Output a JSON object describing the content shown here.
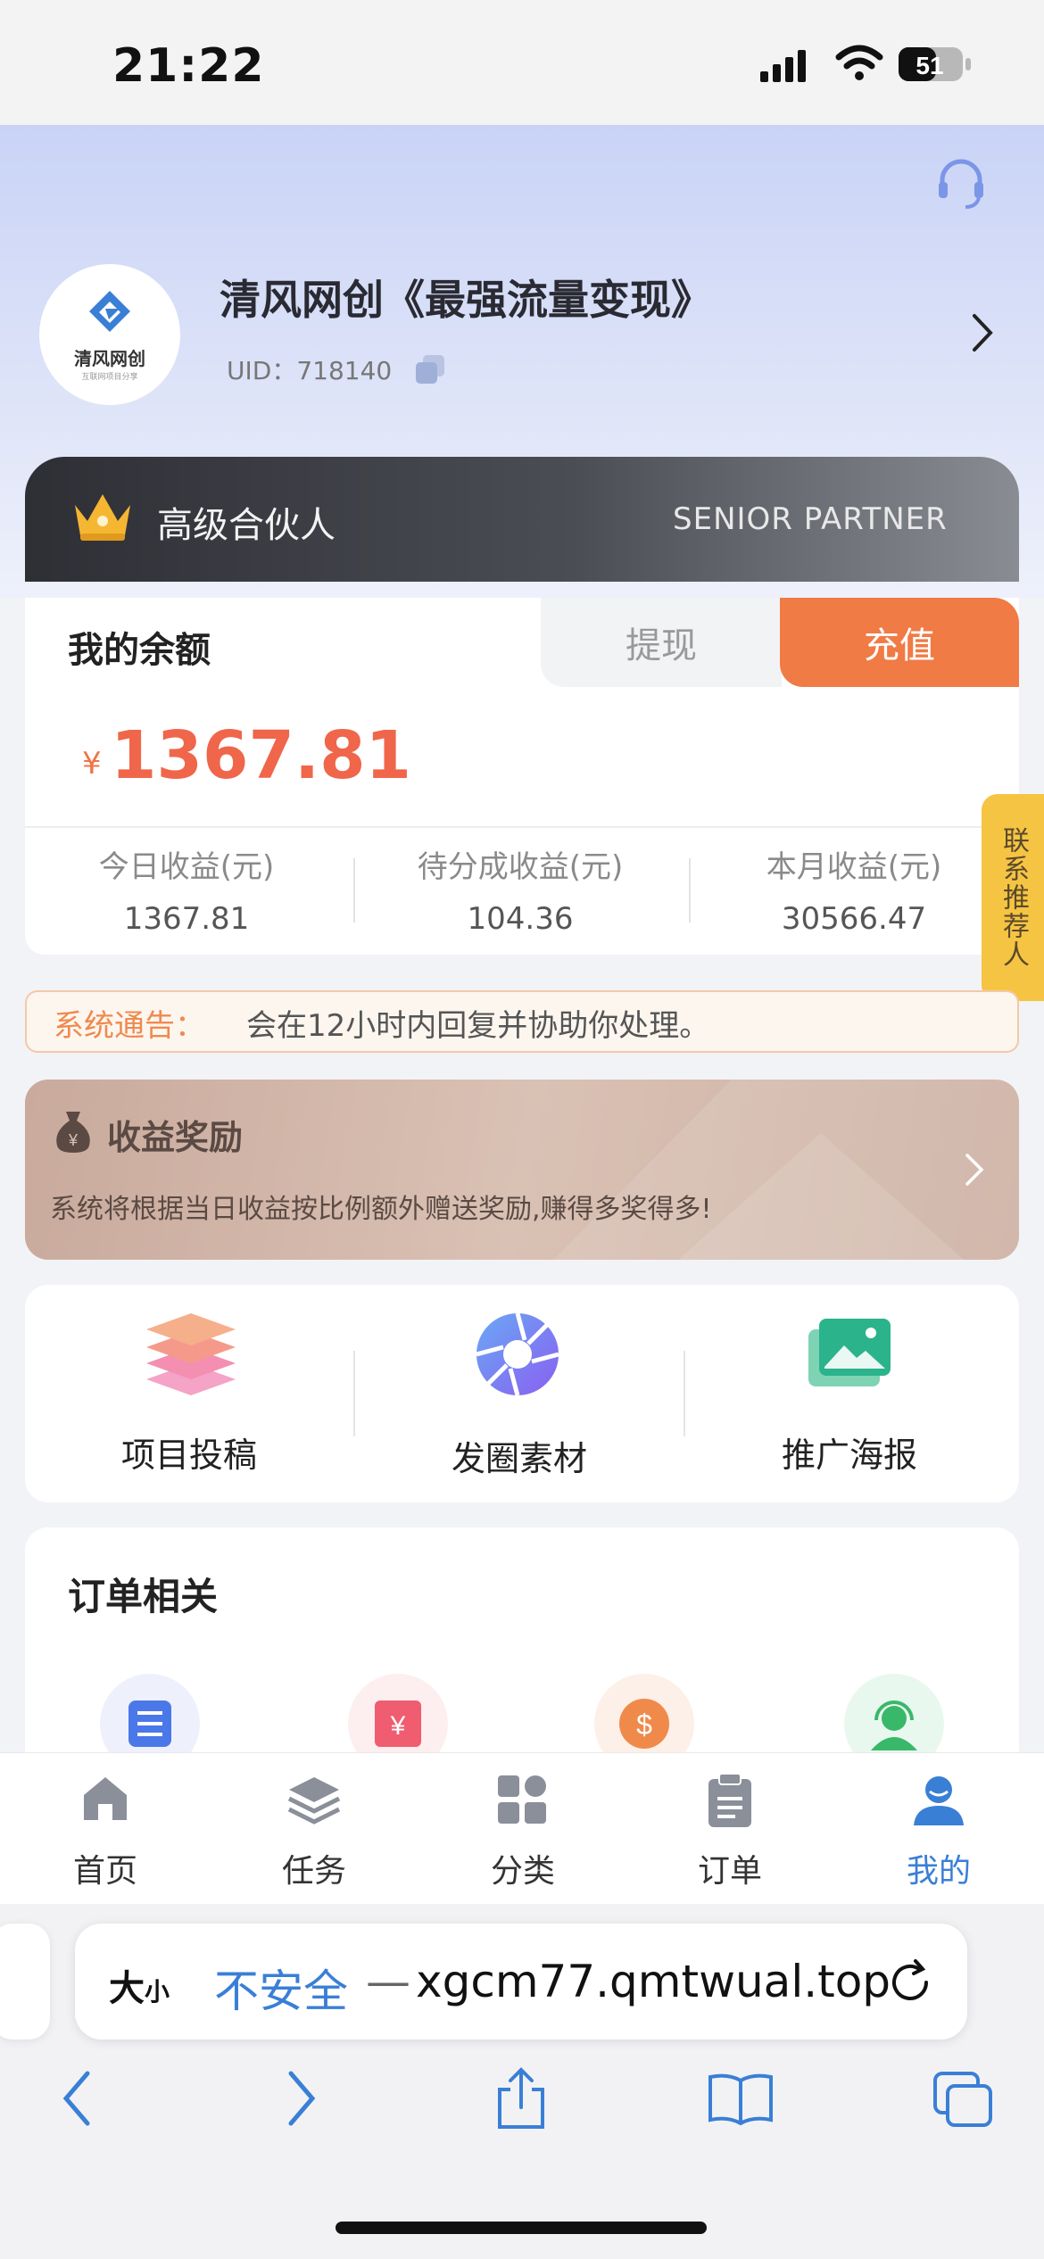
{
  "status_bar": {
    "time": "21:22",
    "battery": "51"
  },
  "profile": {
    "name": "清风网创《最强流量变现》",
    "uid": "UID：718140",
    "logo_text": "清风网创",
    "logo_sub": "互联网项目分享"
  },
  "partner": {
    "label": "高级合伙人",
    "label_en": "SENIOR PARTNER"
  },
  "balance": {
    "title": "我的余额",
    "withdraw_label": "提现",
    "recharge_label": "充值",
    "currency": "¥",
    "amount": "1367.81",
    "stats": [
      {
        "label": "今日收益(元)",
        "value": "1367.81"
      },
      {
        "label": "待分成收益(元)",
        "value": "104.36"
      },
      {
        "label": "本月收益(元)",
        "value": "30566.47"
      }
    ]
  },
  "contact_referrer": "联系推荐人",
  "notice": {
    "label": "系统通告：",
    "text": "会在12小时内回复并协助你处理。"
  },
  "reward": {
    "title": "收益奖励",
    "description": "系统将根据当日收益按比例额外赠送奖励,赚得多奖得多!"
  },
  "quick_actions": [
    {
      "label": "项目投稿",
      "icon": "layers-stack-icon"
    },
    {
      "label": "发圈素材",
      "icon": "aperture-icon"
    },
    {
      "label": "推广海报",
      "icon": "poster-images-icon"
    }
  ],
  "orders": {
    "title": "订单相关",
    "icons": [
      "order-list-icon",
      "invoice-yen-icon",
      "dollar-coin-icon",
      "customer-service-icon"
    ]
  },
  "tab_bar": [
    {
      "label": "首页",
      "icon": "home-icon",
      "active": false
    },
    {
      "label": "任务",
      "icon": "task-layers-icon",
      "active": false
    },
    {
      "label": "分类",
      "icon": "category-grid-icon",
      "active": false
    },
    {
      "label": "订单",
      "icon": "clipboard-icon",
      "active": false
    },
    {
      "label": "我的",
      "icon": "user-icon",
      "active": true
    }
  ],
  "browser": {
    "text_size_label_big": "大",
    "text_size_label_small": "小",
    "insecure_label": "不安全",
    "url_dash": "—",
    "url": "xgcm77.qmtwual.top"
  },
  "colors": {
    "accent_orange": "#f07b45",
    "active_tab_blue": "#3a7fd6",
    "partner_bar_dark": "#2e2f35",
    "side_tab_yellow": "#f6c443"
  }
}
